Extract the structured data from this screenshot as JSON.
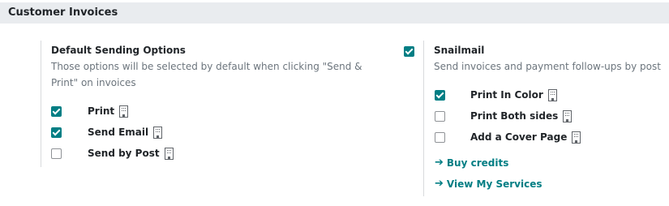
{
  "section": {
    "title": "Customer Invoices"
  },
  "default_sending": {
    "title": "Default Sending Options",
    "description": "Those options will be selected by default when clicking \"Send & Print\" on invoices",
    "options": [
      {
        "label": "Print",
        "checked": true
      },
      {
        "label": "Send Email",
        "checked": true
      },
      {
        "label": "Send by Post",
        "checked": false
      }
    ]
  },
  "snailmail": {
    "checked": true,
    "title": "Snailmail",
    "description": "Send invoices and payment follow-ups by post",
    "options": [
      {
        "label": "Print In Color",
        "checked": true
      },
      {
        "label": "Print Both sides",
        "checked": false
      },
      {
        "label": "Add a Cover Page",
        "checked": false
      }
    ],
    "links": [
      {
        "label": "Buy credits"
      },
      {
        "label": "View My Services"
      }
    ]
  },
  "icons": {
    "option_icon": "building-icon",
    "link_icon": "arrow-right-icon"
  },
  "colors": {
    "accent": "#017e84",
    "header_bg": "#e9ecef",
    "muted_text": "#6c757d"
  }
}
